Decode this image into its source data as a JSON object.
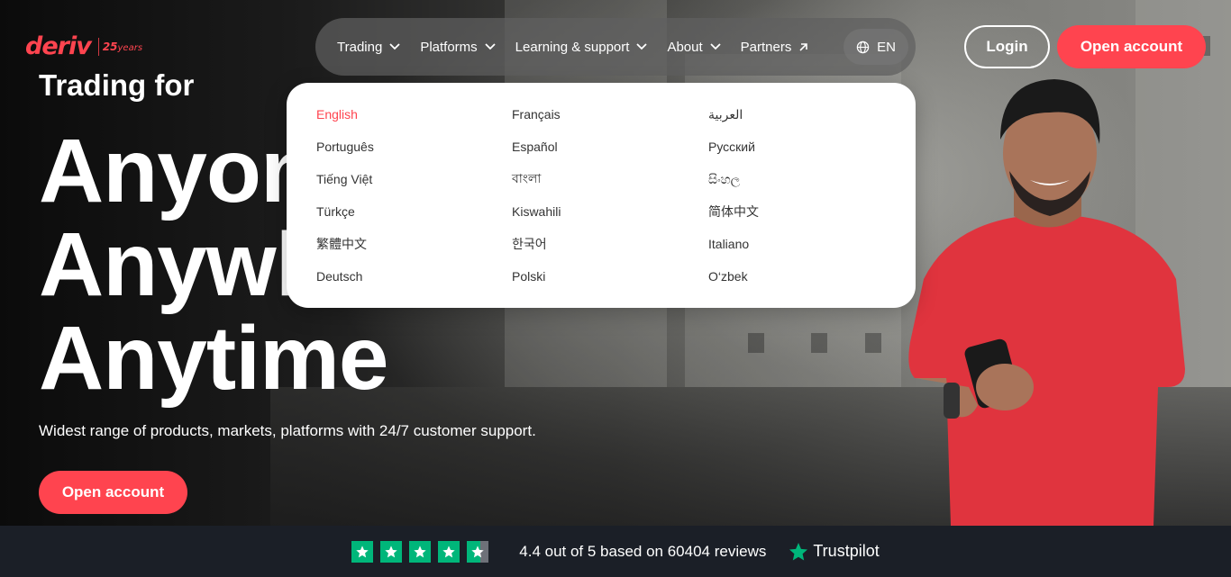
{
  "brand": {
    "name": "deriv",
    "badge_number": "25",
    "badge_text": "years",
    "accent": "#ff444f"
  },
  "nav": {
    "items": [
      {
        "label": "Trading",
        "icon": "chevron-down-icon"
      },
      {
        "label": "Platforms",
        "icon": "chevron-down-icon"
      },
      {
        "label": "Learning & support",
        "icon": "chevron-down-icon"
      },
      {
        "label": "About",
        "icon": "chevron-down-icon"
      },
      {
        "label": "Partners",
        "icon": "arrow-up-right-icon"
      }
    ],
    "language": {
      "label": "EN",
      "icon": "globe-icon"
    }
  },
  "header_actions": {
    "login": "Login",
    "open_account": "Open account"
  },
  "hero": {
    "eyebrow": "Trading for",
    "line1": "Anyone.",
    "line2": "Anywhere.",
    "line3": "Anytime",
    "subtitle": "Widest range of products, markets, platforms with 24/7 customer support.",
    "cta": "Open account"
  },
  "language_menu": {
    "selected": "English",
    "options": [
      "English",
      "Français",
      "العربية",
      "Português",
      "Español",
      "Русский",
      "Tiếng Việt",
      "বাংলা",
      "සිංහල",
      "Türkçe",
      "Kiswahili",
      "简体中文",
      "繁體中文",
      "한국어",
      "Italiano",
      "Deutsch",
      "Polski",
      "O‘zbek"
    ]
  },
  "trustpilot": {
    "stars": 4.4,
    "rating_text": "4.4 out of 5 based on 60404 reviews",
    "brand": "Trustpilot",
    "star_color": "#00b67a"
  }
}
